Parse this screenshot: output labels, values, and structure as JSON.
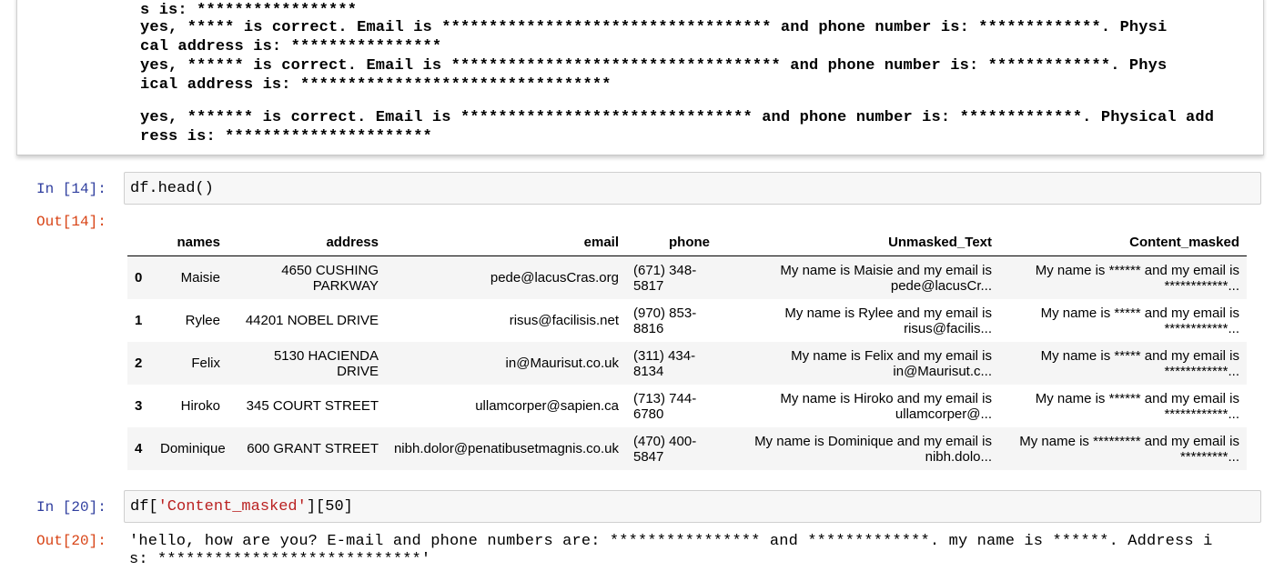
{
  "prev_output": {
    "lines": [
      "s is: *****************",
      "yes, ***** is correct. Email is *********************************** and phone number is: *************. Physi",
      "cal address is: ****************",
      "yes, ****** is correct. Email is *********************************** and phone number is: *************. Phys",
      "ical address is: *********************************",
      "yes, ******* is correct. Email is ******************************* and phone number is: *************. Physical add",
      "ress is: **********************"
    ]
  },
  "cell14": {
    "in_prompt": "In [14]:",
    "code": "df.head()",
    "out_prompt": "Out[14]:",
    "table": {
      "columns": [
        "",
        "names",
        "address",
        "email",
        "phone",
        "Unmasked_Text",
        "Content_masked"
      ],
      "rows": [
        [
          "0",
          "Maisie",
          "4650 CUSHING PARKWAY",
          "pede@lacusCras.org",
          "(671) 348-5817",
          "My name is Maisie and my email is pede@lacusCr...",
          "My name is ****** and my email is ************..."
        ],
        [
          "1",
          "Rylee",
          "44201 NOBEL DRIVE",
          "risus@facilisis.net",
          "(970) 853-8816",
          "My name is Rylee and my email is risus@facilis...",
          "My name is ***** and my email is ************..."
        ],
        [
          "2",
          "Felix",
          "5130 HACIENDA DRIVE",
          "in@Maurisut.co.uk",
          "(311) 434-8134",
          "My name is Felix and my email is in@Maurisut.c...",
          "My name is ***** and my email is ************..."
        ],
        [
          "3",
          "Hiroko",
          "345 COURT STREET",
          "ullamcorper@sapien.ca",
          "(713) 744-6780",
          "My name is Hiroko and my email is ullamcorper@...",
          "My name is ****** and my email is ************..."
        ],
        [
          "4",
          "Dominique",
          "600 GRANT STREET",
          "nibh.dolor@penatibusetmagnis.co.uk",
          "(470) 400-5847",
          "My name is Dominique and my email is nibh.dolo...",
          "My name is ********* and my email is *********..."
        ]
      ]
    }
  },
  "cell20": {
    "in_prompt": "In [20]:",
    "code_prefix": "df[",
    "code_string": "'Content_masked'",
    "code_suffix": "][50]",
    "out_prompt": "Out[20]:",
    "output_lines": [
      "'hello, how are you? E-mail and phone numbers are: **************** and *************. my name is ******. Address i",
      "s: ****************************'"
    ]
  }
}
